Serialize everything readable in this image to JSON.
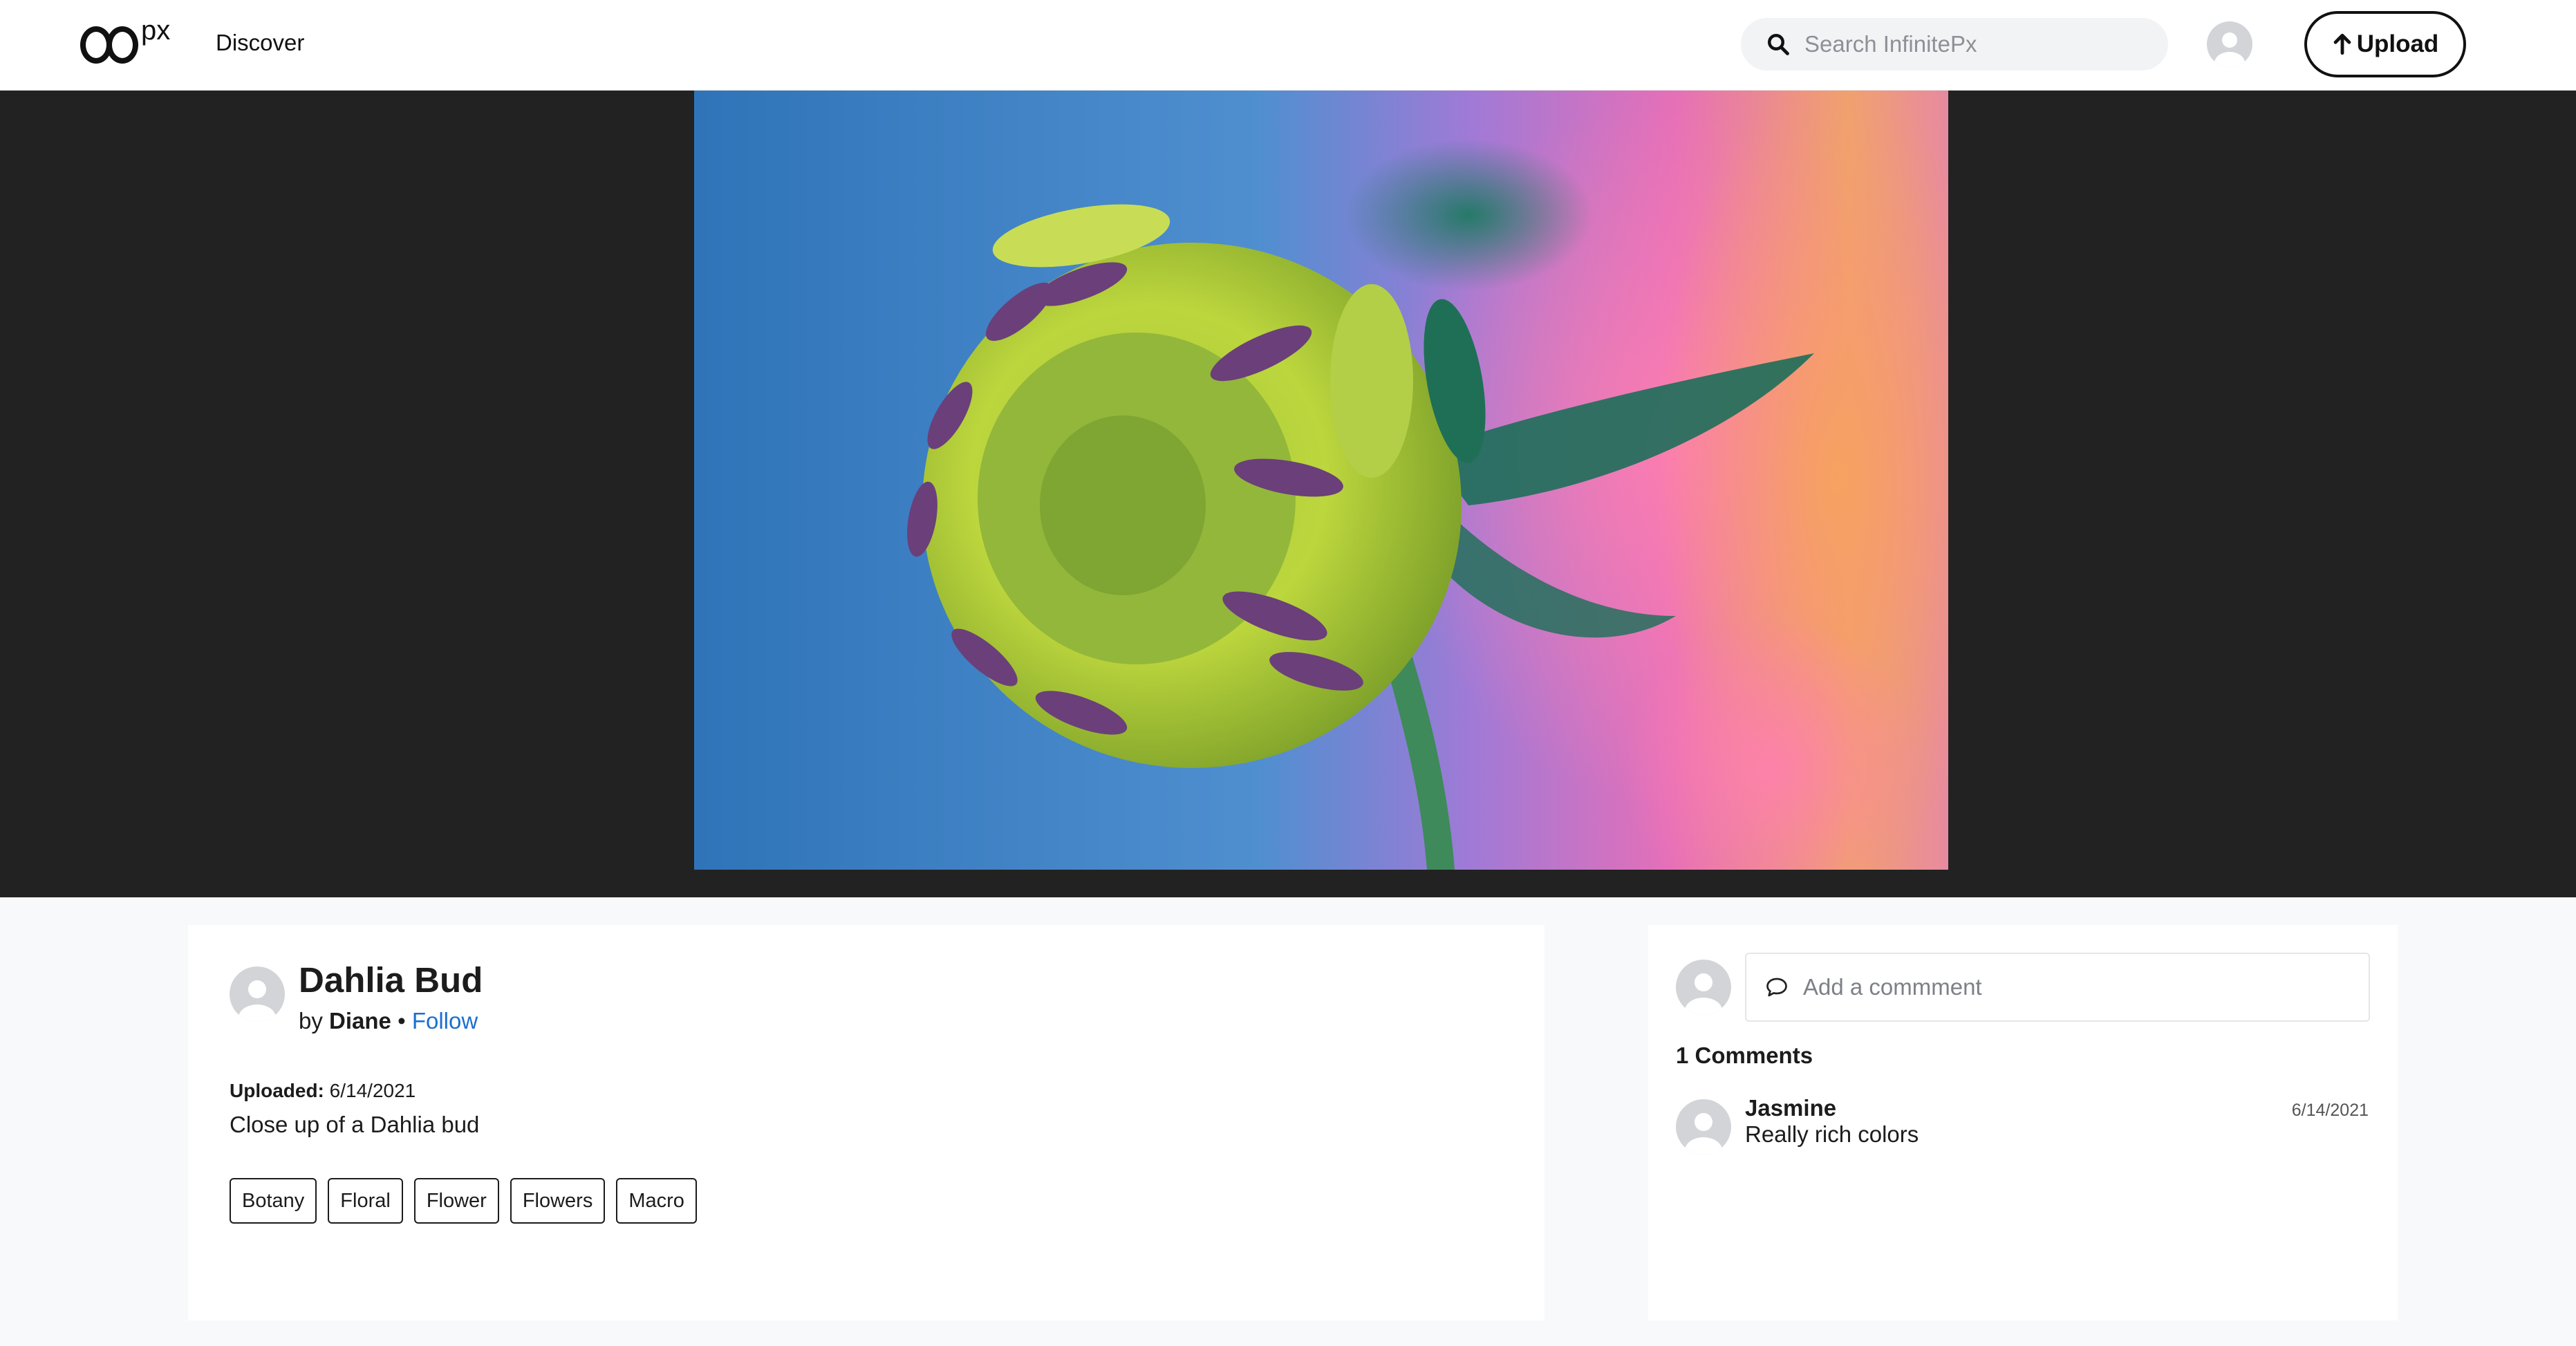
{
  "header": {
    "logo_text": "px",
    "nav_discover": "Discover",
    "search_placeholder": "Search InfinitePx",
    "upload_label": "Upload"
  },
  "photo": {
    "title": "Dahlia Bud",
    "by": "by",
    "author": "Diane",
    "separator": "•",
    "follow_label": "Follow",
    "uploaded_label": "Uploaded:",
    "uploaded_date": "6/14/2021",
    "description": "Close up of a Dahlia bud",
    "tags": [
      "Botany",
      "Floral",
      "Flower",
      "Flowers",
      "Macro"
    ]
  },
  "comments": {
    "input_placeholder": "Add a commment",
    "count_label": "1 Comments",
    "items": [
      {
        "author": "Jasmine",
        "text": "Really rich colors",
        "date": "6/14/2021"
      }
    ]
  },
  "colors": {
    "accent_link": "#1a6fd1",
    "hero_background": "#222222",
    "page_background": "#f8f9fb"
  }
}
